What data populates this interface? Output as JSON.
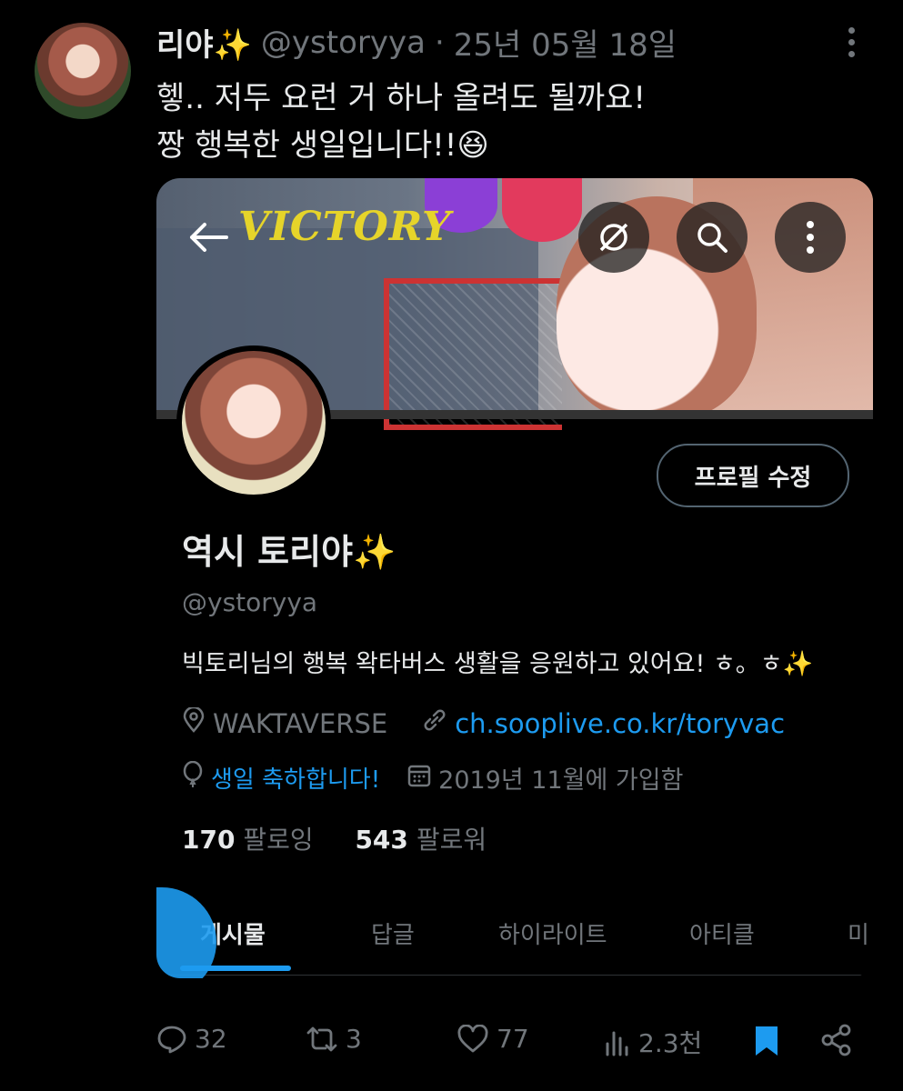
{
  "tweet": {
    "author_name": "리야✨",
    "handle": "@ystoryya",
    "date": "25년 05월 18일",
    "line1": "헿.. 저두 요런 거 하나 올려도 될까요!",
    "line2": "짱 행복한 생일입니다!!😆"
  },
  "profile_card": {
    "banner_text": "VICTORY",
    "edit_button": "프로필 수정",
    "display_name": "역시 토리야✨",
    "handle": "@ystoryya",
    "bio": "빅토리님의 행복 왁타버스 생활을 응원하고 있어요! ㅎ。ㅎ✨",
    "location": "WAKTAVERSE",
    "link": "ch.sooplive.co.kr/toryvac",
    "birthday": "생일 축하합니다!",
    "joined": "2019년 11월에 가입함",
    "following_count": "170",
    "following_label": "팔로잉",
    "followers_count": "543",
    "followers_label": "팔로워",
    "tabs": [
      "게시물",
      "답글",
      "하이라이트",
      "아티클",
      "미"
    ]
  },
  "actions": {
    "replies": "32",
    "reposts": "3",
    "likes": "77",
    "views": "2.3천"
  },
  "colors": {
    "accent": "#1d9bf0",
    "muted": "#71767b",
    "text": "#e7e9ea",
    "bg": "#000000"
  }
}
